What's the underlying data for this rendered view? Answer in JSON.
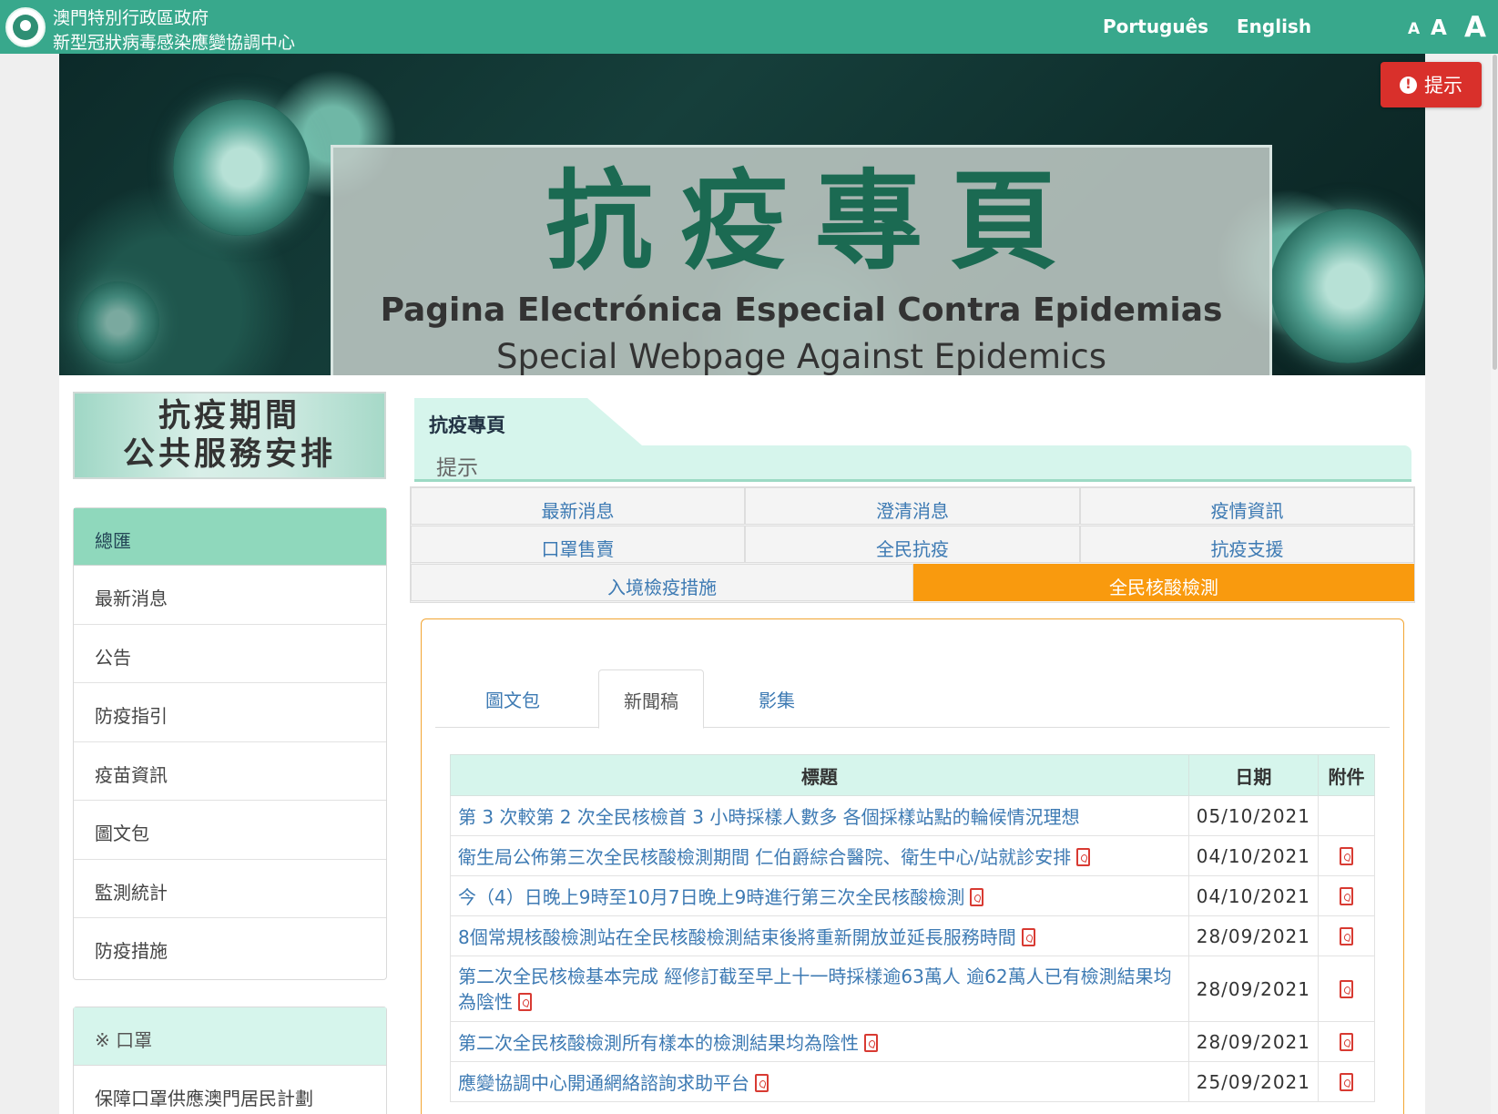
{
  "header": {
    "org_line1": "澳門特別行政區政府",
    "org_line2": "新型冠狀病毒感染應變協調中心",
    "lang_pt": "Português",
    "lang_en": "English",
    "font_small": "A",
    "font_medium": "A",
    "font_large": "A"
  },
  "banner": {
    "title": "抗疫專頁",
    "subtitle_pt": "Pagina Electrónica Especial Contra Epidemias",
    "subtitle_en": "Special Webpage Against Epidemics"
  },
  "alert_button": {
    "label": "提示",
    "icon": "exclamation-circle-icon"
  },
  "sidebar": {
    "promo_line1": "抗疫期間",
    "promo_line2": "公共服務安排",
    "menu_header": "總匯",
    "menu_items": [
      "最新消息",
      "公告",
      "防疫指引",
      "疫苗資訊",
      "圖文包",
      "監測統計",
      "防疫措施"
    ],
    "mask_header": "※ 口罩",
    "mask_items": [
      "保障口罩供應澳門居民計劃"
    ]
  },
  "breadcrumb": {
    "title": "抗疫專頁",
    "sub": "提示"
  },
  "nav": {
    "row1": [
      "最新消息",
      "澄清消息",
      "疫情資訊"
    ],
    "row2": [
      "口罩售賣",
      "全民抗疫",
      "抗疫支援"
    ],
    "row3": [
      "入境檢疫措施",
      "全民核酸檢測"
    ],
    "active": "全民核酸檢測"
  },
  "tabs": {
    "items": [
      "圖文包",
      "新聞稿",
      "影集"
    ],
    "active": "新聞稿"
  },
  "table": {
    "headers": {
      "title": "標題",
      "date": "日期",
      "attachment": "附件"
    },
    "rows": [
      {
        "title": "第 3 次較第 2 次全民核檢首 3 小時採樣人數多 各個採樣站點的輪候情況理想",
        "date": "05/10/2021"
      },
      {
        "title": "衛生局公佈第三次全民核酸檢測期間 仁伯爵綜合醫院、衛生中心/站就診安排",
        "date": "04/10/2021"
      },
      {
        "title": "今（4）日晚上9時至10月7日晚上9時進行第三次全民核酸檢測",
        "date": "04/10/2021"
      },
      {
        "title": "8個常規核酸檢測站在全民核酸檢測結束後將重新開放並延長服務時間",
        "date": "28/09/2021"
      },
      {
        "title": "第二次全民核檢基本完成 經修訂截至早上十一時採樣逾63萬人 逾62萬人已有檢測結果均為陰性",
        "date": "28/09/2021"
      },
      {
        "title": "第二次全民核酸檢測所有樣本的檢測結果均為陰性",
        "date": "28/09/2021"
      },
      {
        "title": "應變協調中心開通網絡諮詢求助平台",
        "date": "25/09/2021"
      }
    ]
  },
  "colors": {
    "header_green": "#38a88c",
    "menu_active": "#8fd8bc",
    "nav_active": "#f99a0e",
    "alert_red": "#d9302b",
    "link_blue": "#3d7ab3"
  }
}
